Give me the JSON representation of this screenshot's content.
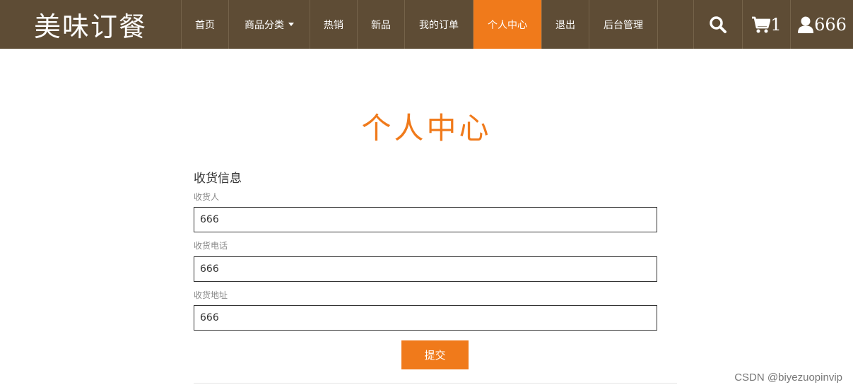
{
  "brand": {
    "name": "美味订餐"
  },
  "nav": {
    "items": [
      {
        "label": "首页"
      },
      {
        "label": "商品分类"
      },
      {
        "label": "热销"
      },
      {
        "label": "新品"
      },
      {
        "label": "我的订单"
      },
      {
        "label": "个人中心",
        "active": true
      },
      {
        "label": "退出"
      },
      {
        "label": "后台管理"
      }
    ],
    "cart_count": "1",
    "user_name": "666"
  },
  "page": {
    "title": "个人中心",
    "section_title": "收货信息",
    "fields": [
      {
        "label": "收货人",
        "value": "666"
      },
      {
        "label": "收货电话",
        "value": "666"
      },
      {
        "label": "收货地址",
        "value": "666"
      }
    ],
    "submit_label": "提交"
  },
  "watermark": "CSDN @biyezuopinvip",
  "colors": {
    "navbar_bg": "#5e4c35",
    "accent": "#f07a1b"
  }
}
